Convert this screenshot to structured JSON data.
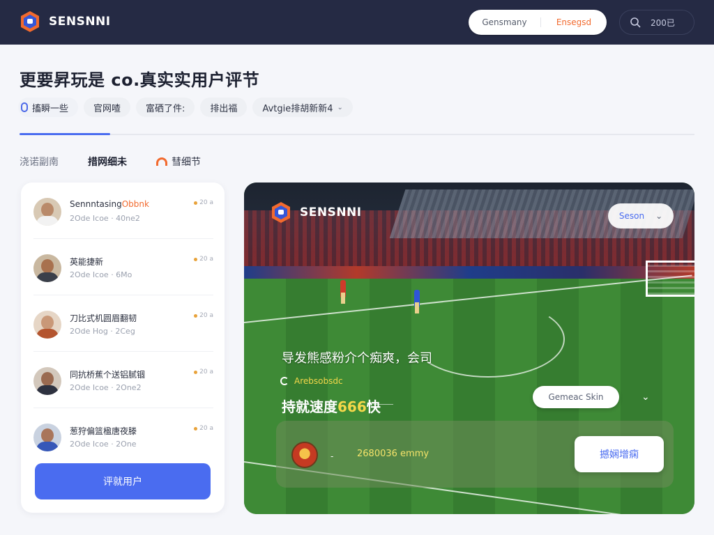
{
  "app": {
    "logo_text": "SENSNNI",
    "logo_accent": "I"
  },
  "topbar": {
    "pill_left": "Gensmany",
    "pill_right": "Ensegsd",
    "search_text": "200已"
  },
  "header": {
    "title": "更要昇玩是 co.真实实用户评节",
    "filters": [
      "搐瞬一些",
      "官网喳",
      "富硒了件:",
      "排出福",
      "Avtgie排胡新新4"
    ]
  },
  "subtabs": [
    "浇诺副南",
    "措网细未",
    "彗细节"
  ],
  "users": [
    {
      "name": "Sennntasing",
      "name_hl": "Obbnk",
      "meta": "2Ode Icoe · 40ne2",
      "badge": "20 a"
    },
    {
      "name": "英能捷新",
      "name_hl": "",
      "meta": "2Ode Icoe · 6Mo",
      "badge": "20 a"
    },
    {
      "name": "刀比式机圆眉翻韧",
      "name_hl": "",
      "meta": "2Ode Hog · 2Ceg",
      "badge": "20 a"
    },
    {
      "name": "同抗桥蕉个送铝腻锢",
      "name_hl": "",
      "meta": "2Ode Icoe · 2One2",
      "badge": "20 a"
    },
    {
      "name": "葱狩偏篮楹唐夜滕",
      "name_hl": "",
      "meta": "2Ode Icoe · 2One",
      "badge": "20 a"
    }
  ],
  "add_user_label": "评就用户",
  "stadium": {
    "logo_text": "SENSNNI",
    "season_label": "Seson",
    "headline": "导发熊感粉介个痴爽，会司",
    "small_line": "Arebsobsdc",
    "speed_prefix": "持就速度",
    "speed_num": "666",
    "speed_suffix": "快",
    "ghost_btn": "Gemeac Skin",
    "bottom_text": "2680036 emmy",
    "bottom_sep": "-",
    "cta_label": "撼娴增痫"
  },
  "colors": {
    "topbar_bg": "#252a44",
    "accent_blue": "#4a6cf0",
    "accent_orange": "#f26a2e",
    "highlight_yellow": "#f5d84a"
  },
  "icons": [
    "logo-mark-icon",
    "search-icon",
    "pin-icon",
    "flame-icon",
    "chevron-down-icon",
    "spinner-icon",
    "club-badge-icon"
  ]
}
